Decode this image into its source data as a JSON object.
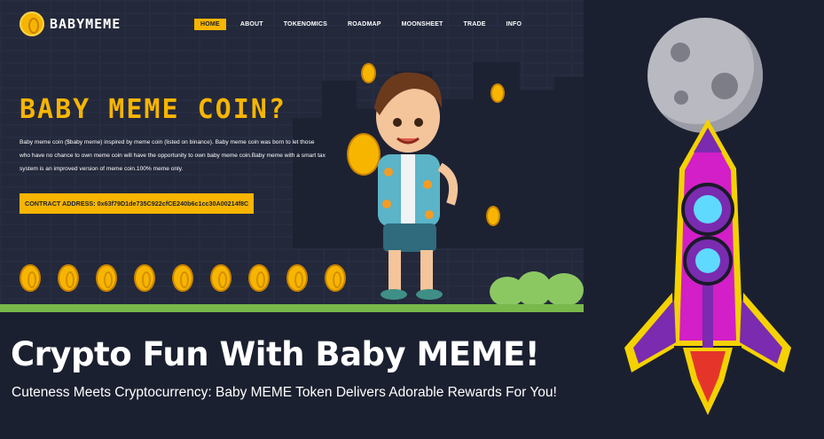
{
  "nav": {
    "logo_text": "BABYMEME",
    "items": [
      {
        "label": "HOME",
        "active": true
      },
      {
        "label": "ABOUT"
      },
      {
        "label": "TOKENOMICS"
      },
      {
        "label": "ROADMAP"
      },
      {
        "label": "MOONSHEET"
      },
      {
        "label": "TRADE"
      },
      {
        "label": "INFO"
      }
    ]
  },
  "hero": {
    "title": "BABY MEME COIN?",
    "description": "Baby meme coin ($baby meme) inspired by meme coin (listed on binance). Baby meme coin was born to let those who have no chance to own meme coin will have the opportunity to own baby meme coin.Baby meme with a smart tax system is an improved version of meme coin.100% meme only.",
    "contract_label": "CONTRACT ADDRESS: 0x63f79D1de735C922cfCE240b6c1cc30A00214f8C"
  },
  "banner": {
    "headline": "Crypto Fun With Baby MEME!",
    "subline": "Cuteness Meets Cryptocurrency: Baby MEME Token Delivers Adorable Rewards For You!"
  },
  "colors": {
    "accent": "#f7b500",
    "background": "#1b2030",
    "rocket": "#d21fc7"
  },
  "icons": [
    "coin-icon",
    "moon-icon",
    "rocket-icon"
  ]
}
